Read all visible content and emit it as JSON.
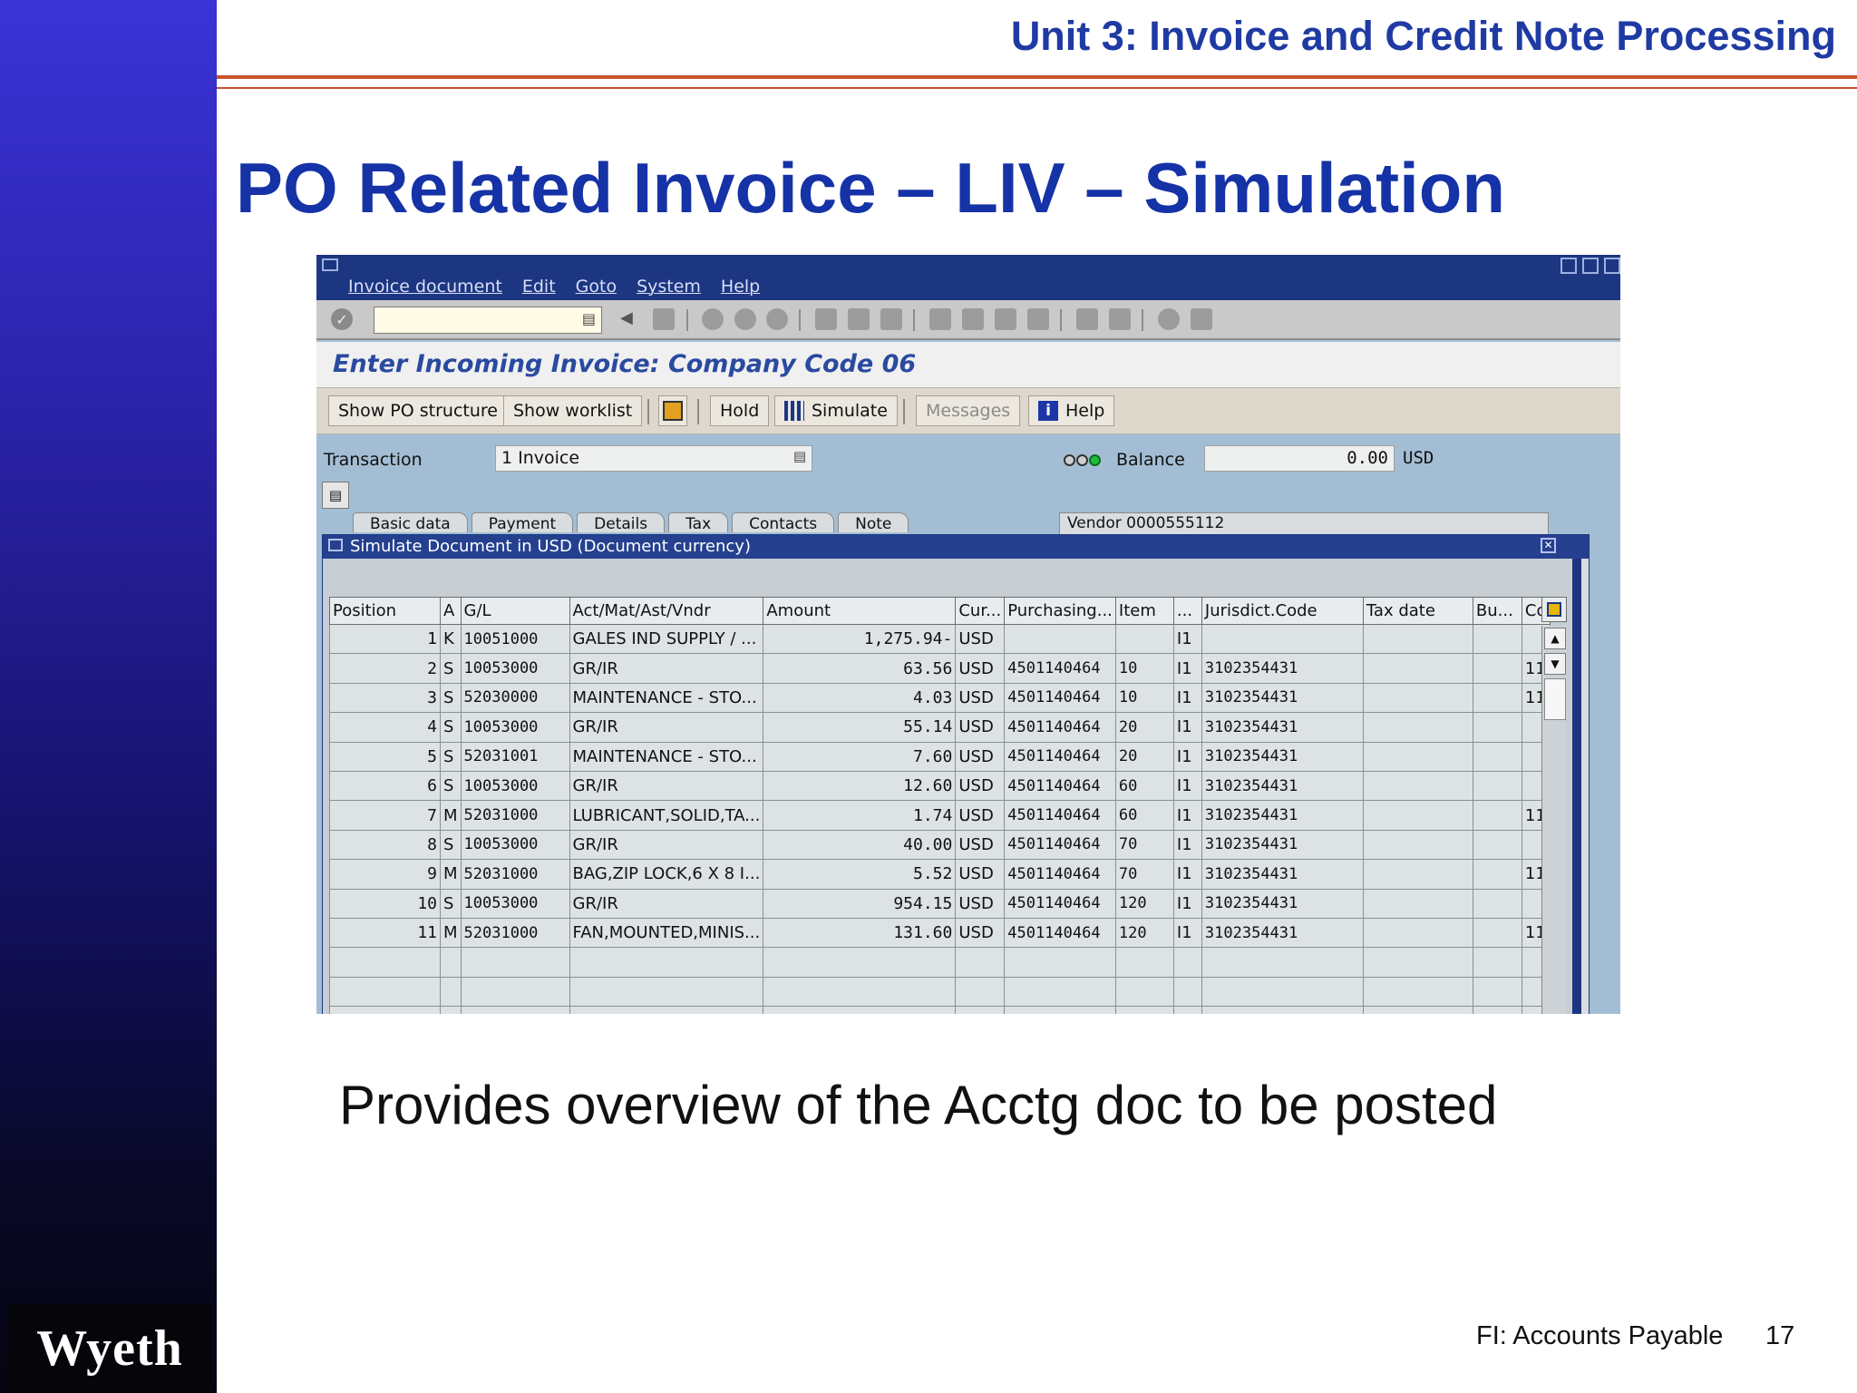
{
  "slide": {
    "unit_title": "Unit 3: Invoice and Credit Note Processing",
    "title": "PO Related Invoice –  LIV – Simulation",
    "caption": "Provides overview of the Acctg doc to be posted",
    "footer": "FI: Accounts Payable",
    "page_number": "17",
    "logo": "Wyeth"
  },
  "sap": {
    "menu": [
      "Invoice document",
      "Edit",
      "Goto",
      "System",
      "Help"
    ],
    "command_field": "",
    "screen_title": "Enter Incoming Invoice: Company Code 06",
    "app_toolbar": {
      "show_po_structure": "Show PO structure",
      "show_worklist": "Show worklist",
      "hold": "Hold",
      "simulate": "Simulate",
      "messages": "Messages",
      "help": "Help"
    },
    "transaction_label": "Transaction",
    "transaction_value": "1 Invoice",
    "balance_label": "Balance",
    "balance_value": "0.00",
    "balance_currency": "USD",
    "tabs": [
      "Basic data",
      "Payment",
      "Details",
      "Tax",
      "Contacts",
      "Note"
    ],
    "vendor_tab": "Vendor 0000555112",
    "popup": {
      "title": "Simulate Document in USD (Document currency)",
      "columns": [
        "Position",
        "A",
        "G/L",
        "Act/Mat/Ast/Vndr",
        "Amount",
        "Cur...",
        "Purchasing...",
        "Item",
        "...",
        "Jurisdict.Code",
        "Tax date",
        "Bu...",
        "Co"
      ],
      "rows": [
        [
          "1",
          "K",
          "10051000",
          "GALES IND SUPPLY / ...",
          "1,275.94-",
          "USD",
          "",
          "",
          "I1",
          "",
          "",
          "",
          ""
        ],
        [
          "2",
          "S",
          "10053000",
          "GR/IR",
          "63.56",
          "USD",
          "4501140464",
          "10",
          "I1",
          "3102354431",
          "",
          "",
          "11"
        ],
        [
          "3",
          "S",
          "52030000",
          "MAINTENANCE - STO...",
          "4.03",
          "USD",
          "4501140464",
          "10",
          "I1",
          "3102354431",
          "",
          "",
          "11"
        ],
        [
          "4",
          "S",
          "10053000",
          "GR/IR",
          "55.14",
          "USD",
          "4501140464",
          "20",
          "I1",
          "3102354431",
          "",
          "",
          ""
        ],
        [
          "5",
          "S",
          "52031001",
          "MAINTENANCE - STO...",
          "7.60",
          "USD",
          "4501140464",
          "20",
          "I1",
          "3102354431",
          "",
          "",
          ""
        ],
        [
          "6",
          "S",
          "10053000",
          "GR/IR",
          "12.60",
          "USD",
          "4501140464",
          "60",
          "I1",
          "3102354431",
          "",
          "",
          ""
        ],
        [
          "7",
          "M",
          "52031000",
          "LUBRICANT,SOLID,TA...",
          "1.74",
          "USD",
          "4501140464",
          "60",
          "I1",
          "3102354431",
          "",
          "",
          "11"
        ],
        [
          "8",
          "S",
          "10053000",
          "GR/IR",
          "40.00",
          "USD",
          "4501140464",
          "70",
          "I1",
          "3102354431",
          "",
          "",
          ""
        ],
        [
          "9",
          "M",
          "52031000",
          "BAG,ZIP LOCK,6 X 8 I...",
          "5.52",
          "USD",
          "4501140464",
          "70",
          "I1",
          "3102354431",
          "",
          "",
          "11"
        ],
        [
          "10",
          "S",
          "10053000",
          "GR/IR",
          "954.15",
          "USD",
          "4501140464",
          "120",
          "I1",
          "3102354431",
          "",
          "",
          ""
        ],
        [
          "11",
          "M",
          "52031000",
          "FAN,MOUNTED,MINIS...",
          "131.60",
          "USD",
          "4501140464",
          "120",
          "I1",
          "3102354431",
          "",
          "",
          "11"
        ]
      ],
      "empty_rows": 3
    }
  }
}
